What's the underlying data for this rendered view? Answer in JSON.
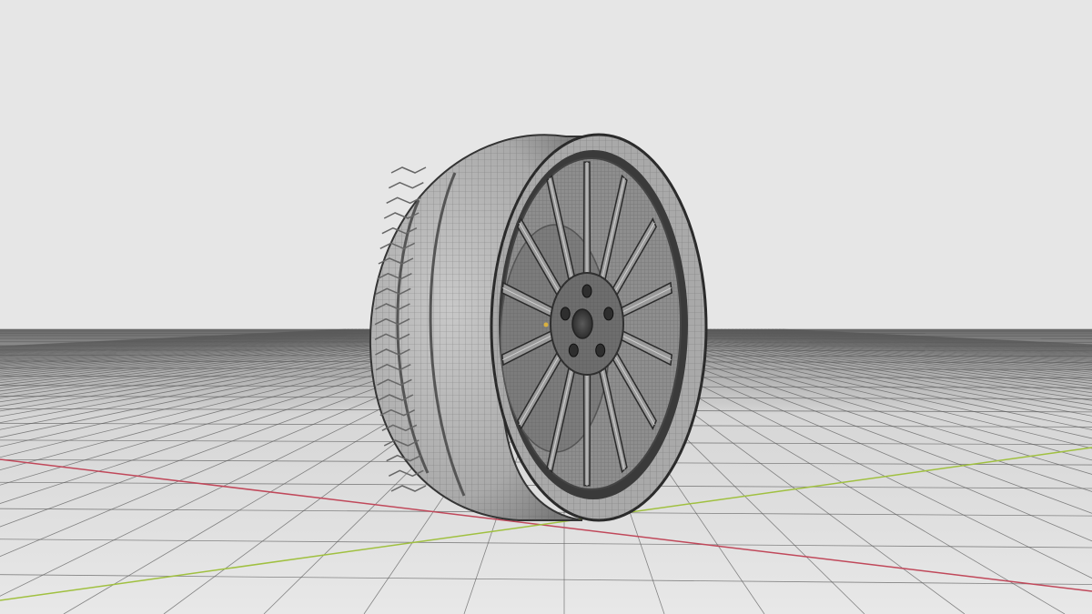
{
  "scene": {
    "background_color": "#e6e6e6",
    "object": "car-wheel",
    "render_mode": "wireframe-on-shaded",
    "spoke_count": 14,
    "lug_nut_count": 5,
    "grid_color": "#5a5a5a",
    "x_axis_color": "#c0485a",
    "y_axis_color": "#a0c040",
    "tire_color": "#b4b4b4",
    "rim_color": "#9a9a9a"
  }
}
